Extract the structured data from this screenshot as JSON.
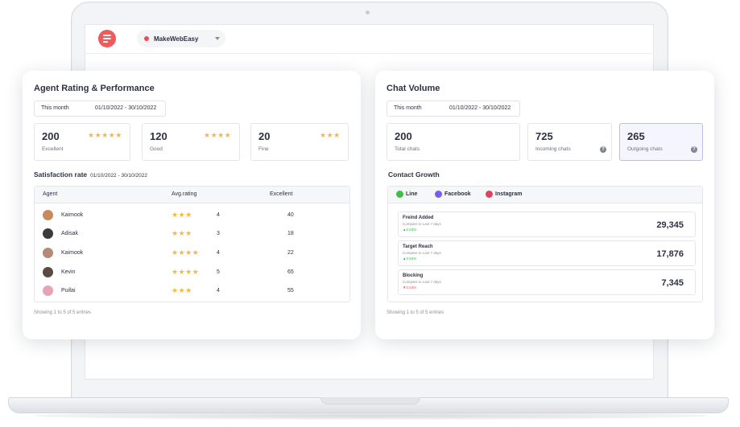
{
  "header": {
    "workspace": "MakeWebEasy"
  },
  "agent_card": {
    "title": "Agent Rating & Performance",
    "period_label": "This month",
    "period_range": "01/10/2022 - 30/10/2022",
    "stats": [
      {
        "value": "200",
        "label": "Excellent",
        "stars": "★★★★★"
      },
      {
        "value": "120",
        "label": "Good",
        "stars": "★★★★"
      },
      {
        "value": "20",
        "label": "Fine",
        "stars": "★★★"
      }
    ],
    "satisfaction_title": "Satisfaction rate",
    "satisfaction_range": "01/10/2022 - 30/10/2022",
    "table": {
      "columns": [
        "Agent",
        "Avg.rating",
        "Excellent"
      ],
      "rows": [
        {
          "name": "Kaimook",
          "stars": "★★★",
          "avg": "4",
          "excellent": "40",
          "avatar_color": "#c98a5b"
        },
        {
          "name": "Adisak",
          "stars": "★★★",
          "avg": "3",
          "excellent": "18",
          "avatar_color": "#3e3a3a"
        },
        {
          "name": "Kaimook",
          "stars": "★★★★",
          "avg": "4",
          "excellent": "22",
          "avatar_color": "#b48b74"
        },
        {
          "name": "Kevin",
          "stars": "★★★★",
          "avg": "5",
          "excellent": "65",
          "avatar_color": "#5a4a44"
        },
        {
          "name": "Puifai",
          "stars": "★★★",
          "avg": "4",
          "excellent": "55",
          "avatar_color": "#e7a3b3"
        }
      ]
    },
    "footer": "Showing 1 to 5 of 5 entries"
  },
  "chat_card": {
    "title": "Chat Volume",
    "period_label": "This month",
    "period_range": "01/10/2022 - 30/10/2022",
    "stats": [
      {
        "value": "200",
        "label": "Total chats"
      },
      {
        "value": "725",
        "label": "Incoming chats"
      },
      {
        "value": "265",
        "label": "Outgoing chats"
      }
    ],
    "growth_title": "Contact Growth",
    "tabs": [
      {
        "label": "Line",
        "color": "#3ec043"
      },
      {
        "label": "Facebook",
        "color": "#7b5cf0"
      },
      {
        "label": "Instagram",
        "color": "#e4405f"
      }
    ],
    "metrics": [
      {
        "title": "Freind Added",
        "compare": "Compare to Last 7 days",
        "percent": "▲0.53%",
        "value": "29,345"
      },
      {
        "title": "Target Reach",
        "compare": "Compare to Last 7 days",
        "percent": "▲0.53%",
        "value": "17,876"
      },
      {
        "title": "Blocking",
        "compare": "Compare to Last 7 days",
        "percent": "▼0.53%",
        "value": "7,345"
      }
    ],
    "footer": "Showing 1 to 5 of 5 entries"
  },
  "colors": {
    "accent": "#f05a5b",
    "star": "#f5b83d",
    "selected_border": "#b9bde8",
    "selected_bg": "#f5f6fd"
  }
}
